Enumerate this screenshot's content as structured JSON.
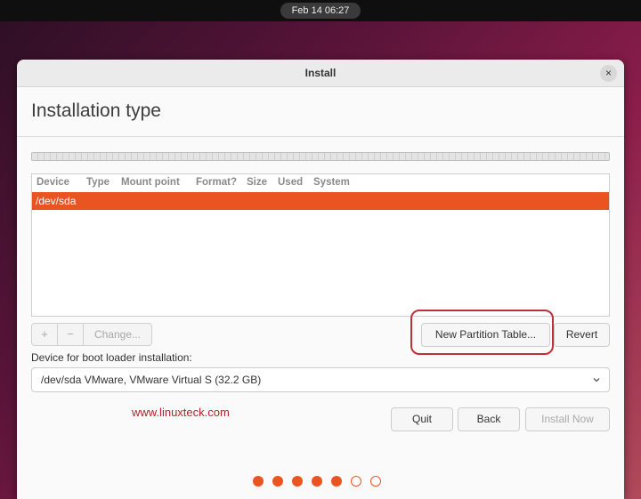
{
  "topbar": {
    "clock": "Feb 14  06:27"
  },
  "window": {
    "title": "Install",
    "close_glyph": "×"
  },
  "page": {
    "heading": "Installation type"
  },
  "partition_table": {
    "columns": [
      "Device",
      "Type",
      "Mount point",
      "Format?",
      "Size",
      "Used",
      "System"
    ],
    "rows": [
      {
        "device": "/dev/sda",
        "selected": true
      }
    ]
  },
  "toolbar": {
    "add_label": "+",
    "remove_label": "−",
    "change_label": "Change..."
  },
  "buttons": {
    "new_partition_table": "New Partition Table...",
    "revert": "Revert",
    "quit": "Quit",
    "back": "Back",
    "install_now": "Install Now"
  },
  "bootloader": {
    "label": "Device for boot loader installation:",
    "selected": "/dev/sda VMware, VMware Virtual S (32.2 GB)"
  },
  "watermark": "www.linuxteck.com",
  "progress": {
    "total_steps": 7,
    "completed_steps": 5
  },
  "colors": {
    "accent": "#e95420",
    "highlight": "#c0303a"
  },
  "icons": {
    "close": "close-icon",
    "dropdown": "chevron-down-icon"
  }
}
